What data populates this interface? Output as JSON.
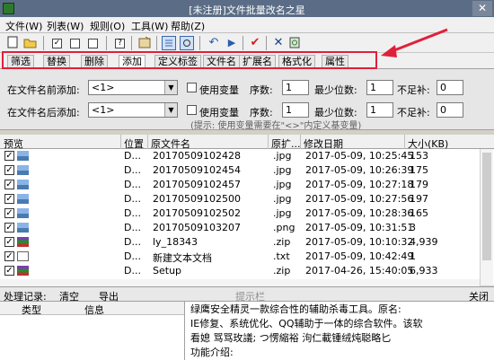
{
  "window": {
    "title": "[未注册]文件批量改名之星",
    "close": "✕"
  },
  "menu": [
    {
      "label": "文件(W)"
    },
    {
      "label": "列表(W)"
    },
    {
      "label": "规则(O)"
    },
    {
      "label": "工具(W)"
    },
    {
      "label": "帮助(Z)"
    }
  ],
  "tabs": [
    {
      "label": "筛选"
    },
    {
      "label": "替换"
    },
    {
      "label": "删除"
    },
    {
      "label": "添加"
    },
    {
      "label": "定义标签"
    },
    {
      "label": "文件名"
    },
    {
      "label": "扩展名"
    },
    {
      "label": "格式化"
    },
    {
      "label": "属性"
    }
  ],
  "options": {
    "before_label": "在文件名前添加:",
    "before_value": "<1>",
    "after_label": "在文件名后添加:",
    "after_value": "<1>",
    "use_var": "使用变量",
    "seq_label": "序数:",
    "seq_value": "1",
    "min_digits_label": "最少位数:",
    "min_digits_value": "1",
    "pad_label": "不足补:",
    "pad_value": "0",
    "hint": "(提示: 使用变量需要在\"<>\"内定义基变量)"
  },
  "columns": {
    "preview": "预览",
    "location": "位置",
    "orig_name": "原文件名",
    "ext": "原扩...",
    "modified": "修改日期",
    "size": "大小(KB)"
  },
  "files": [
    {
      "loc": "D...",
      "name": "20170509102428",
      "ext": ".jpg",
      "date": "2017-05-09, 10:25:45",
      "size": "153",
      "kind": "img"
    },
    {
      "loc": "D...",
      "name": "20170509102454",
      "ext": ".jpg",
      "date": "2017-05-09, 10:26:39",
      "size": "175",
      "kind": "img"
    },
    {
      "loc": "D...",
      "name": "20170509102457",
      "ext": ".jpg",
      "date": "2017-05-09, 10:27:18",
      "size": "179",
      "kind": "img"
    },
    {
      "loc": "D...",
      "name": "20170509102500",
      "ext": ".jpg",
      "date": "2017-05-09, 10:27:56",
      "size": "197",
      "kind": "img"
    },
    {
      "loc": "D...",
      "name": "20170509102502",
      "ext": ".jpg",
      "date": "2017-05-09, 10:28:36",
      "size": "165",
      "kind": "img"
    },
    {
      "loc": "D...",
      "name": "20170509103207",
      "ext": ".png",
      "date": "2017-05-09, 10:31:51",
      "size": "3",
      "kind": "img"
    },
    {
      "loc": "D...",
      "name": "ly_18343",
      "ext": ".zip",
      "date": "2017-05-09, 10:10:32",
      "size": "4,939",
      "kind": "zip"
    },
    {
      "loc": "D...",
      "name": "新建文本文档",
      "ext": ".txt",
      "date": "2017-05-09, 10:42:49",
      "size": "1",
      "kind": "txt"
    },
    {
      "loc": "D...",
      "name": "Setup",
      "ext": ".zip",
      "date": "2017-04-26, 15:40:05",
      "size": "6,933",
      "kind": "zip"
    }
  ],
  "bottom": {
    "log_label": "处理记录:",
    "clear": "清空",
    "export": "导出",
    "hintbar": "提示栏",
    "close": "关闭",
    "col_type": "类型",
    "col_info": "信息"
  },
  "info_lines": [
    "绿鹰安全精灵一款综合性的辅助杀毒工具。原名:",
    "IE修复、系统优化、QQ辅助于一体的综合软件。该软",
    "看媳  骂骂玫議; つ愣縮裕  泃仁載锺绒炖聪略匕",
    "功能介绍:"
  ],
  "colors": {
    "title_bg": "#5b6d86",
    "annotation": "#e0203a"
  }
}
